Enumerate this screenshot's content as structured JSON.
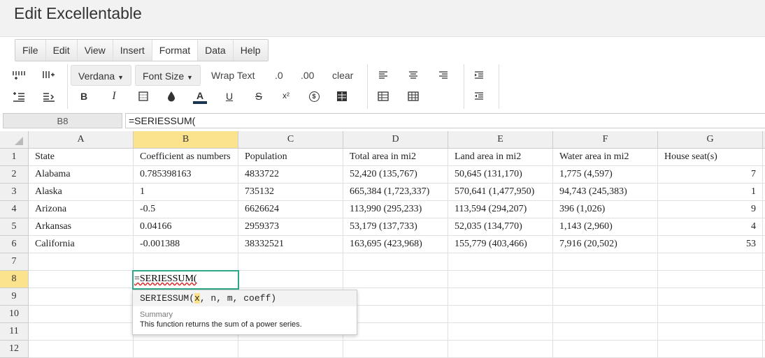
{
  "app": {
    "title": "Edit Excellentable"
  },
  "menu": [
    {
      "label": "File",
      "active": false
    },
    {
      "label": "Edit",
      "active": false
    },
    {
      "label": "View",
      "active": false
    },
    {
      "label": "Insert",
      "active": false
    },
    {
      "label": "Format",
      "active": true
    },
    {
      "label": "Data",
      "active": false
    },
    {
      "label": "Help",
      "active": false
    }
  ],
  "toolbar": {
    "font_label": "Verdana",
    "font_size_label": "Font Size",
    "wrap_text_label": "Wrap Text",
    "decimal_decrease_label": ".0",
    "decimal_increase_label": ".00",
    "clear_label": "clear",
    "bold_label": "B",
    "italic_label": "I",
    "font_color_label": "A",
    "underline_label": "U",
    "strike_label": "S",
    "superscript_label": "x²",
    "currency_label": "$"
  },
  "formula_bar": {
    "cell_ref": "B8",
    "value": "=SERIESSUM("
  },
  "columns": [
    "A",
    "B",
    "C",
    "D",
    "E",
    "F",
    "G"
  ],
  "selected_column": "B",
  "selected_row": "8",
  "rows": [
    {
      "n": "1",
      "cells": [
        "State",
        "Coefficient as numbers",
        "Population",
        "Total area in mi2",
        "Land area in mi2",
        "Water area in mi2",
        "House seat(s)"
      ]
    },
    {
      "n": "2",
      "cells": [
        "Alabama",
        "0.785398163",
        "4833722",
        "52,420 (135,767)",
        "50,645 (131,170)",
        "1,775 (4,597)",
        "7"
      ]
    },
    {
      "n": "3",
      "cells": [
        "Alaska",
        "1",
        "735132",
        "665,384 (1,723,337)",
        "570,641 (1,477,950)",
        "94,743 (245,383)",
        "1"
      ]
    },
    {
      "n": "4",
      "cells": [
        "Arizona",
        "-0.5",
        "6626624",
        "113,990 (295,233)",
        "113,594 (294,207)",
        "396 (1,026)",
        "9"
      ]
    },
    {
      "n": "5",
      "cells": [
        "Arkansas",
        "0.04166",
        "2959373",
        "53,179 (137,733)",
        "52,035 (134,770)",
        "1,143 (2,960)",
        "4"
      ]
    },
    {
      "n": "6",
      "cells": [
        "California",
        "-0.001388",
        "38332521",
        "163,695 (423,968)",
        "155,779 (403,466)",
        "7,916 (20,502)",
        "53"
      ]
    },
    {
      "n": "7",
      "cells": [
        "",
        "",
        "",
        "",
        "",
        "",
        ""
      ]
    },
    {
      "n": "8",
      "cells": [
        "",
        "",
        "",
        "",
        "",
        "",
        ""
      ]
    },
    {
      "n": "9",
      "cells": [
        "",
        "",
        "",
        "",
        "",
        "",
        ""
      ]
    },
    {
      "n": "10",
      "cells": [
        "",
        "",
        "",
        "",
        "",
        "",
        ""
      ]
    },
    {
      "n": "11",
      "cells": [
        "",
        "",
        "",
        "",
        "",
        "",
        ""
      ]
    },
    {
      "n": "12",
      "cells": [
        "",
        "",
        "",
        "",
        "",
        "",
        ""
      ]
    }
  ],
  "numeric_column_index": 6,
  "editor": {
    "value": "=SERIESSUM("
  },
  "autocomplete": {
    "fn": "SERIESSUM(",
    "arg_highlight": "x",
    "rest": ", n, m, coeff)",
    "summary_heading": "Summary",
    "summary_text": "This function returns the sum of a power series."
  }
}
